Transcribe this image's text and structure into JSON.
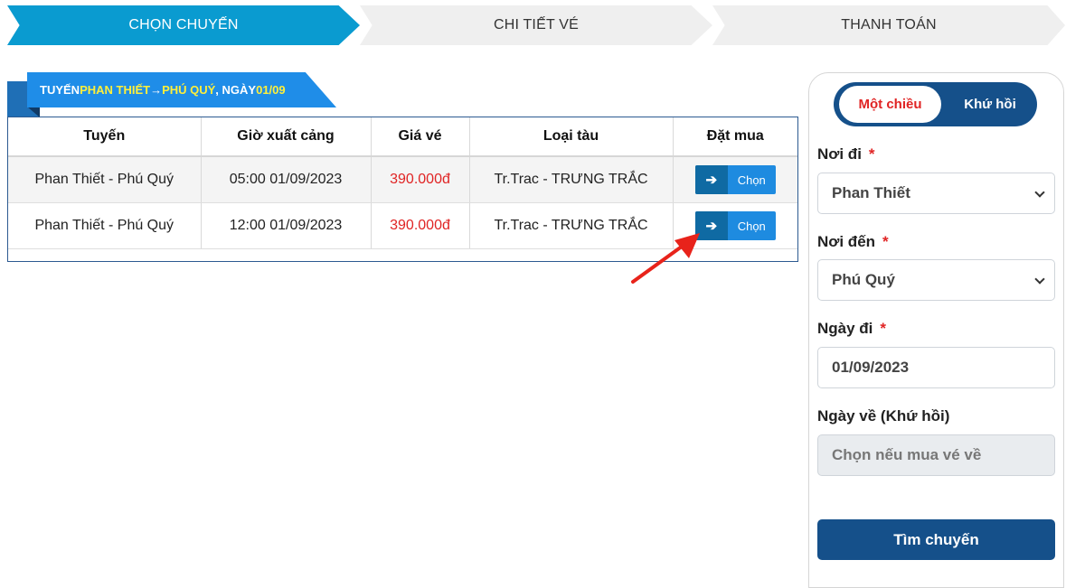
{
  "steps": [
    {
      "label": "CHỌN CHUYẾN",
      "active": true
    },
    {
      "label": "CHI TIẾT VÉ",
      "active": false
    },
    {
      "label": "THANH TOÁN",
      "active": false
    }
  ],
  "route_banner": {
    "prefix": "TUYẾN ",
    "from": "PHAN THIẾT",
    "arrow": " → ",
    "to": "PHÚ QUÝ",
    "date_prefix": ", NGÀY ",
    "date": "01/09"
  },
  "table": {
    "headers": [
      "Tuyến",
      "Giờ xuất cảng",
      "Giá vé",
      "Loại tàu",
      "Đặt mua"
    ],
    "rows": [
      {
        "route": "Phan Thiết - Phú Quý",
        "departure": "05:00 01/09/2023",
        "price": "390.000đ",
        "vessel": "Tr.Trac - TRƯNG TRẮC",
        "action": "Chọn"
      },
      {
        "route": "Phan Thiết - Phú Quý",
        "departure": "12:00 01/09/2023",
        "price": "390.000đ",
        "vessel": "Tr.Trac - TRƯNG TRẮC",
        "action": "Chọn"
      }
    ],
    "action_icon": "arrow-right-icon"
  },
  "search": {
    "trip_type": {
      "one_way": "Một chiều",
      "round_trip": "Khứ hồi",
      "selected": "one_way"
    },
    "from_label": "Nơi đi",
    "from_value": "Phan Thiết",
    "to_label": "Nơi đến",
    "to_value": "Phú Quý",
    "depart_label": "Ngày đi",
    "depart_value": "01/09/2023",
    "return_label": "Ngày về (Khứ hồi)",
    "return_placeholder": "Chọn nếu mua vé về",
    "required_mark": "*",
    "submit_label": "Tìm chuyến"
  },
  "colors": {
    "active_step": "#0a9bd0",
    "banner": "#1f8de8",
    "banner_highlight": "#ffef3a",
    "primary_dark": "#15508a",
    "price": "#e02424",
    "annotation_arrow": "#e8231b"
  }
}
